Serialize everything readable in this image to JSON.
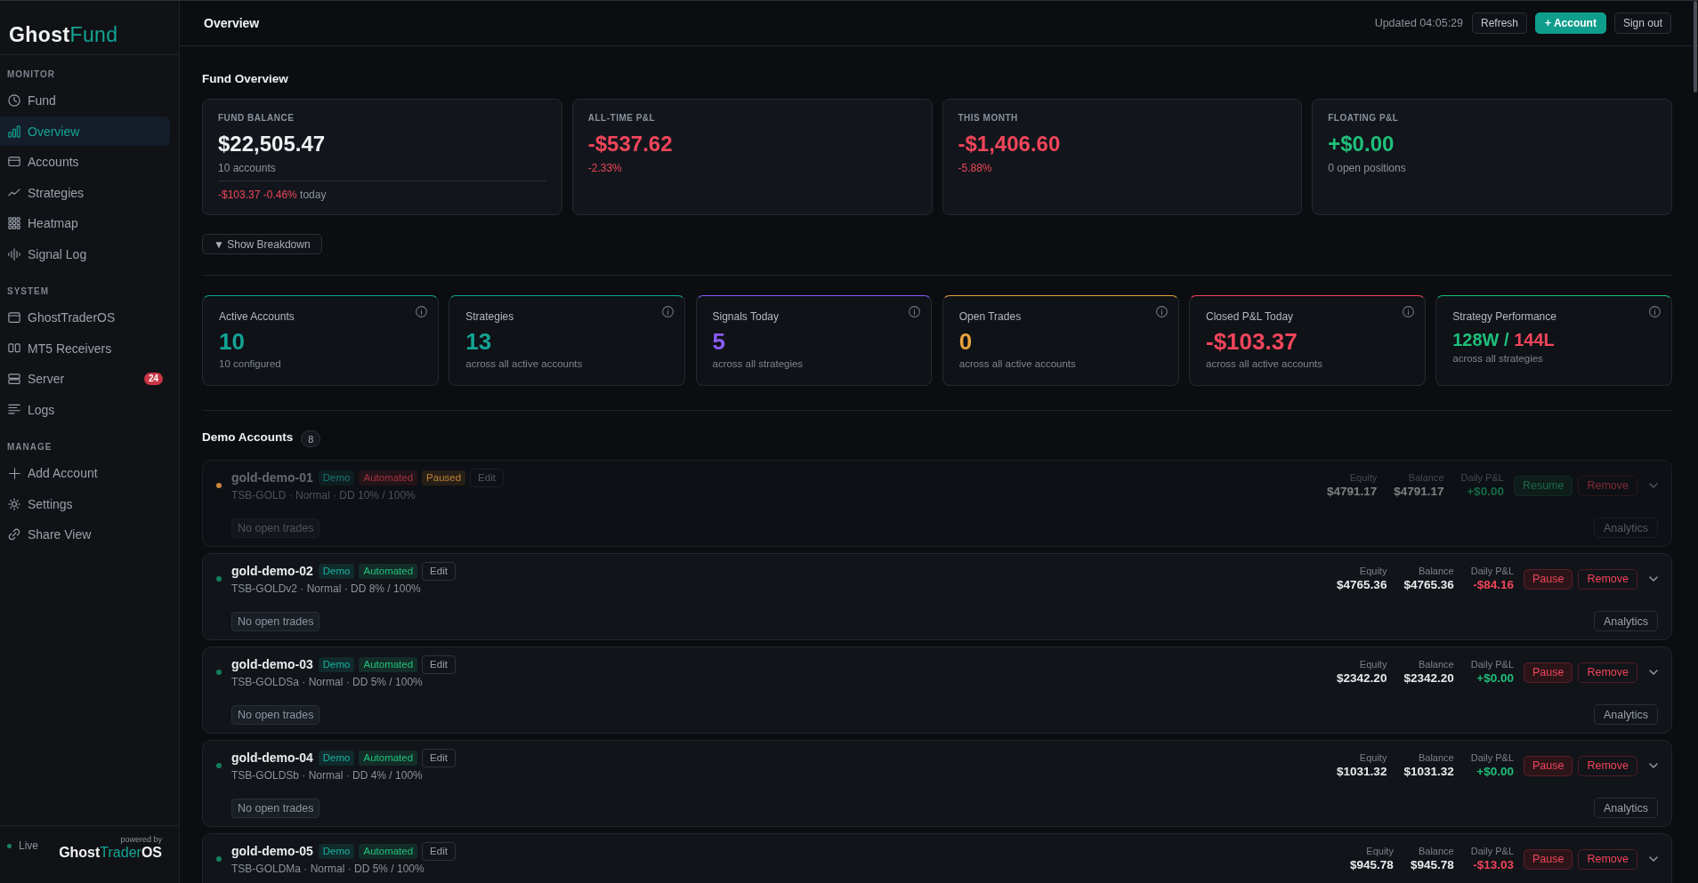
{
  "sidebar": {
    "logo": {
      "parts": [
        {
          "text": "Ghost",
          "accent": false
        },
        {
          "text": "Fund",
          "accent": true
        }
      ]
    },
    "sections": [
      {
        "title": "MONITOR",
        "items": [
          {
            "label": "Fund",
            "selected": false
          },
          {
            "label": "Overview",
            "selected": true
          },
          {
            "label": "Accounts",
            "selected": false
          },
          {
            "label": "Strategies",
            "selected": false
          },
          {
            "label": "Heatmap",
            "selected": false
          },
          {
            "label": "Signal Log",
            "selected": false
          }
        ]
      },
      {
        "title": "SYSTEM",
        "items": [
          {
            "label": "GhostTraderOS",
            "selected": false
          },
          {
            "label": "MT5 Receivers",
            "selected": false
          },
          {
            "label": "Server",
            "selected": false,
            "badge": "24"
          },
          {
            "label": "Logs",
            "selected": false
          }
        ]
      },
      {
        "title": "MANAGE",
        "items": [
          {
            "label": "Add Account",
            "selected": false
          },
          {
            "label": "Settings",
            "selected": false
          },
          {
            "label": "Share View",
            "selected": false
          }
        ]
      }
    ],
    "footer": {
      "status": {
        "label": "Live",
        "color": "#17865c"
      },
      "powered_by": "powered by",
      "logo": {
        "parts": [
          {
            "text": "Ghost",
            "accent": false
          },
          {
            "text": "Trader",
            "accent": true
          },
          {
            "text": "OS",
            "accent": false
          }
        ]
      }
    }
  },
  "topbar": {
    "title": "Overview",
    "updated": "Updated 04:05:29",
    "buttons": [
      {
        "label": "Refresh",
        "kind": "secondary"
      },
      {
        "label": "+ Account",
        "kind": "primary"
      },
      {
        "label": "Sign out",
        "kind": "secondary"
      }
    ]
  },
  "fund_overview": {
    "title": "Fund Overview",
    "cards": [
      {
        "label": "FUND BALANCE",
        "value": {
          "text": "$22,505.47",
          "kind": "neutral"
        },
        "note": {
          "text": "10 accounts",
          "kind": "muted"
        },
        "change": {
          "text": "-$103.37 -0.46%",
          "kind": "negative",
          "suffix": "today"
        }
      },
      {
        "label": "ALL-TIME P&L",
        "value": {
          "text": "-$537.62",
          "kind": "negative"
        },
        "note": {
          "text": "-2.33%",
          "kind": "negative"
        }
      },
      {
        "label": "THIS MONTH",
        "value": {
          "text": "-$1,406.60",
          "kind": "negative"
        },
        "note": {
          "text": "-5.88%",
          "kind": "negative"
        }
      },
      {
        "label": "FLOATING P&L",
        "value": {
          "text": "+$0.00",
          "kind": "positive"
        },
        "note": {
          "text": "0 open positions",
          "kind": "muted"
        }
      }
    ],
    "breakdown_button": "▼ Show Breakdown"
  },
  "stats": [
    {
      "kind": "number",
      "label": "Active Accounts",
      "value": "10",
      "note": "10 configured",
      "color": "#14a394"
    },
    {
      "kind": "number",
      "label": "Strategies",
      "value": "13",
      "note": "across all active accounts",
      "color": "#14a394"
    },
    {
      "kind": "number",
      "label": "Signals Today",
      "value": "5",
      "note": "across all strategies",
      "color": "#8b5cf6"
    },
    {
      "kind": "number",
      "label": "Open Trades",
      "value": "0",
      "note": "across all active accounts",
      "color": "#e8a33d"
    },
    {
      "kind": "number",
      "label": "Closed P&L Today",
      "value": "-$103.37",
      "note": "across all active accounts",
      "color": "#f0455a"
    },
    {
      "kind": "ratio",
      "label": "Strategy Performance",
      "wins": "128W",
      "separator": "/",
      "losses": "144L",
      "note": "across all strategies",
      "color": "#1fbf7a"
    }
  ],
  "demo_accounts": {
    "title": "Demo Accounts",
    "count": "8",
    "accounts": [
      {
        "name": "gold-demo-01",
        "paused": true,
        "color": "#c8873a",
        "tags": [
          {
            "label": "Demo",
            "color": "#177a72"
          },
          {
            "label": "Automated",
            "color": "#a8323d"
          },
          {
            "label": "Paused",
            "color": "#c28232"
          }
        ],
        "edit": "Edit",
        "details": "TSB-GOLD · Normal · DD 10% / 100%",
        "stats": [
          {
            "label": "Equity",
            "value": "$4791.17",
            "kind": "neutral"
          },
          {
            "label": "Balance",
            "value": "$4791.17",
            "kind": "neutral"
          },
          {
            "label": "Daily P&L",
            "value": "+$0.00",
            "kind": "positive"
          }
        ],
        "action": {
          "label": "Resume",
          "kind": "resume"
        },
        "remove": "Remove",
        "expanded": false,
        "trades": "No open trades",
        "analytics": "Analytics"
      },
      {
        "name": "gold-demo-02",
        "paused": false,
        "color": "#14805a",
        "tags": [
          {
            "label": "Demo",
            "color": "#18b3a0"
          },
          {
            "label": "Automated",
            "color": "#20c17c"
          }
        ],
        "edit": "Edit",
        "details": "TSB-GOLDv2 · Normal · DD 8% / 100%",
        "stats": [
          {
            "label": "Equity",
            "value": "$4765.36",
            "kind": "neutral"
          },
          {
            "label": "Balance",
            "value": "$4765.36",
            "kind": "neutral"
          },
          {
            "label": "Daily P&L",
            "value": "-$84.16",
            "kind": "negative"
          }
        ],
        "action": {
          "label": "Pause",
          "kind": "pause"
        },
        "remove": "Remove",
        "expanded": false,
        "trades": "No open trades",
        "analytics": "Analytics"
      },
      {
        "name": "gold-demo-03",
        "paused": false,
        "color": "#14805a",
        "tags": [
          {
            "label": "Demo",
            "color": "#18b3a0"
          },
          {
            "label": "Automated",
            "color": "#20c17c"
          }
        ],
        "edit": "Edit",
        "details": "TSB-GOLDSa · Normal · DD 5% / 100%",
        "stats": [
          {
            "label": "Equity",
            "value": "$2342.20",
            "kind": "neutral"
          },
          {
            "label": "Balance",
            "value": "$2342.20",
            "kind": "neutral"
          },
          {
            "label": "Daily P&L",
            "value": "+$0.00",
            "kind": "positive"
          }
        ],
        "action": {
          "label": "Pause",
          "kind": "pause"
        },
        "remove": "Remove",
        "expanded": false,
        "trades": "No open trades",
        "analytics": "Analytics"
      },
      {
        "name": "gold-demo-04",
        "paused": false,
        "color": "#14805a",
        "tags": [
          {
            "label": "Demo",
            "color": "#18b3a0"
          },
          {
            "label": "Automated",
            "color": "#20c17c"
          }
        ],
        "edit": "Edit",
        "details": "TSB-GOLDSb · Normal · DD 4% / 100%",
        "stats": [
          {
            "label": "Equity",
            "value": "$1031.32",
            "kind": "neutral"
          },
          {
            "label": "Balance",
            "value": "$1031.32",
            "kind": "neutral"
          },
          {
            "label": "Daily P&L",
            "value": "+$0.00",
            "kind": "positive"
          }
        ],
        "action": {
          "label": "Pause",
          "kind": "pause"
        },
        "remove": "Remove",
        "expanded": false,
        "trades": "No open trades",
        "analytics": "Analytics"
      },
      {
        "name": "gold-demo-05",
        "paused": false,
        "color": "#14805a",
        "tags": [
          {
            "label": "Demo",
            "color": "#18b3a0"
          },
          {
            "label": "Automated",
            "color": "#20c17c"
          }
        ],
        "edit": "Edit",
        "details": "TSB-GOLDMa · Normal · DD 5% / 100%",
        "stats": [
          {
            "label": "Equity",
            "value": "$945.78",
            "kind": "neutral"
          },
          {
            "label": "Balance",
            "value": "$945.78",
            "kind": "neutral"
          },
          {
            "label": "Daily P&L",
            "value": "-$13.03",
            "kind": "negative"
          }
        ],
        "action": {
          "label": "Pause",
          "kind": "pause"
        },
        "remove": "Remove",
        "expanded": false
      }
    ]
  }
}
